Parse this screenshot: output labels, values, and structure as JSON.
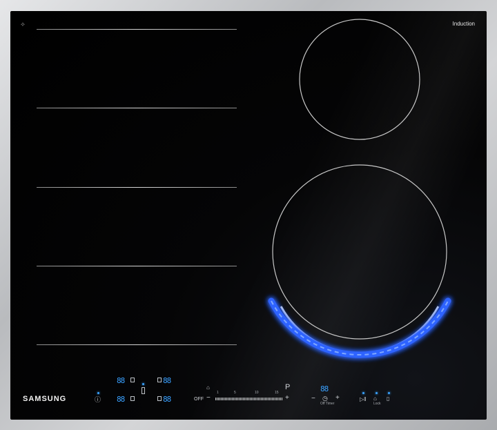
{
  "hob": {
    "zone_label": "Induction",
    "brand": "SAMSUNG",
    "wifi_icon": "wifi-icon",
    "colors": {
      "glow": "#2f63ff",
      "display": "#39a0ff",
      "frame": "#c6c8cb"
    }
  },
  "controls": {
    "display_top_left": "88",
    "display_top_right": "88",
    "display_bottom_left": "88",
    "display_bottom_right": "88",
    "off_label": "OFF",
    "minus": "−",
    "plus": "+",
    "power_boost": "P",
    "scale": [
      "1",
      "5",
      "10",
      "15"
    ],
    "timer_display": "88",
    "timer_minus": "−",
    "timer_plus": "+",
    "timer_caption": "Off Timer",
    "lock_caption": "Lock"
  }
}
